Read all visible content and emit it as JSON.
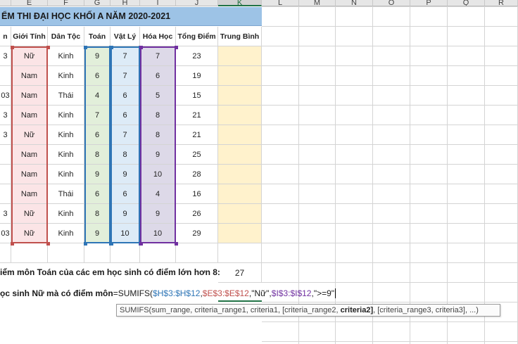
{
  "columns": [
    "E",
    "F",
    "G",
    "H",
    "I",
    "J",
    "K",
    "L",
    "M",
    "N",
    "O",
    "P",
    "Q",
    "R"
  ],
  "title": "ỂM THI ĐẠI HỌC KHỐI A NĂM 2020-2021",
  "headers": [
    "n",
    "Giới Tính",
    "Dân Tộc",
    "Toán",
    "Vật Lý",
    "Hóa Học",
    "Tổng Điểm",
    "Trung Bình"
  ],
  "rows": [
    {
      "c": "3",
      "gender": "Nữ",
      "ethnic": "Kinh",
      "math": "9",
      "physics": "7",
      "chem": "7",
      "total": "23"
    },
    {
      "c": "",
      "gender": "Nam",
      "ethnic": "Kinh",
      "math": "6",
      "physics": "7",
      "chem": "6",
      "total": "19"
    },
    {
      "c": "03",
      "gender": "Nam",
      "ethnic": "Thái",
      "math": "4",
      "physics": "6",
      "chem": "5",
      "total": "15"
    },
    {
      "c": "3",
      "gender": "Nam",
      "ethnic": "Kinh",
      "math": "7",
      "physics": "6",
      "chem": "8",
      "total": "21"
    },
    {
      "c": "3",
      "gender": "Nữ",
      "ethnic": "Kinh",
      "math": "6",
      "physics": "7",
      "chem": "8",
      "total": "21"
    },
    {
      "c": "",
      "gender": "Nam",
      "ethnic": "Kinh",
      "math": "8",
      "physics": "8",
      "chem": "9",
      "total": "25"
    },
    {
      "c": "",
      "gender": "Nam",
      "ethnic": "Kinh",
      "math": "9",
      "physics": "9",
      "chem": "10",
      "total": "28"
    },
    {
      "c": "",
      "gender": "Nam",
      "ethnic": "Thái",
      "math": "6",
      "physics": "6",
      "chem": "4",
      "total": "16"
    },
    {
      "c": "3",
      "gender": "Nữ",
      "ethnic": "Kinh",
      "math": "8",
      "physics": "9",
      "chem": "9",
      "total": "26"
    },
    {
      "c": "03",
      "gender": "Nữ",
      "ethnic": "Kinh",
      "math": "9",
      "physics": "10",
      "chem": "10",
      "total": "29"
    }
  ],
  "summary1": {
    "label": "iểm môn Toán của các em học sinh có điểm lớn hơn 8:",
    "value": "27"
  },
  "summary2": {
    "label": "ọc sinh Nữ mà có điểm môn"
  },
  "formula": {
    "prefix": "=SUMIFS(",
    "arg1": "$H$3:$H$12",
    "sep1": ",",
    "arg2": "$E$3:$E$12",
    "sep2": ",",
    "arg3": "\"Nữ\"",
    "sep3": ",",
    "arg4": "$I$3:$I$12",
    "sep4": ",",
    "arg5": "\">=9\""
  },
  "tooltip": {
    "text1": "SUMIFS(sum_range, criteria_range1, criteria1, [criteria_range2, ",
    "bold": "criteria2]",
    "text2": ", [criteria_range3, criteria3], ...)"
  },
  "colors": {
    "arg1": "#2e75b6",
    "arg2": "#c0504d",
    "arg3": "#1a1a1a",
    "arg4": "#7030a0",
    "accent": "#217346"
  }
}
